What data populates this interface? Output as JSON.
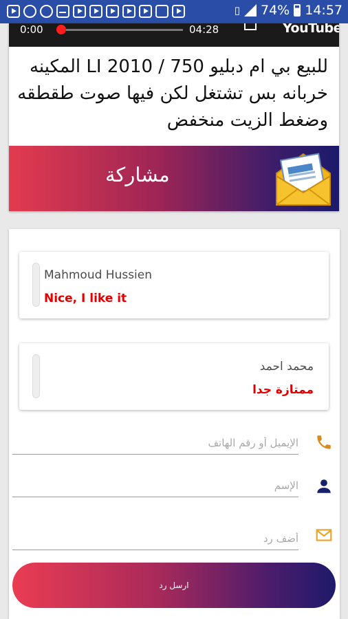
{
  "status_bar": {
    "battery": "74%",
    "time": "14:57",
    "icons": [
      "youtube-icon",
      "messenger-icon",
      "phone-icon",
      "whatsapp-icon",
      "youtube-icon",
      "youtube-icon",
      "youtube-icon",
      "youtube-icon",
      "youtube-icon",
      "gallery-icon",
      "youtube-icon",
      "signal-icon",
      "battery-icon"
    ]
  },
  "video": {
    "current_time": "0:00",
    "duration": "04:28",
    "progress": 0,
    "brand": "YouTube"
  },
  "post": {
    "title": "للبيع بي ام دبليو 750 / LI 2010 المكينه خربانه بس تشتغل لكن فيها صوت طقطقه وضغط الزيت منخفض"
  },
  "share": {
    "label": "مشاركة",
    "colors": {
      "start": "#e23b4f",
      "end": "#1c1a6b"
    }
  },
  "comments": [
    {
      "author": "Mahmoud Hussien",
      "text": "Nice, I like it"
    },
    {
      "author": "محمد احمد",
      "text": "ممتازة جدا"
    }
  ],
  "form": {
    "contact_placeholder": "الإيميل أو رقم الهاتف",
    "name_placeholder": "الإسم",
    "reply_placeholder": "أضف رد",
    "send_label": "ارسل رد",
    "icon_colors": {
      "phone": "#d98b1d",
      "person": "#16206b",
      "mail": "#e8a52b"
    }
  }
}
